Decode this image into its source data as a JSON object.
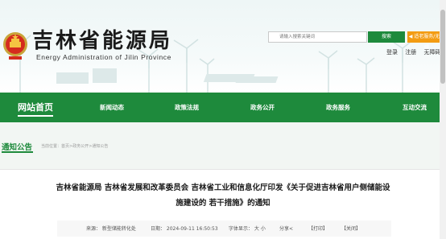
{
  "header": {
    "site_title": "吉林省能源局",
    "site_subtitle": "Energy Administration of Jilin Province",
    "search_placeholder": "请输入搜索关键词",
    "search_button": "搜索",
    "voice_button": "◀ 适老服务/无障碍",
    "top_links": [
      "登录",
      "注册",
      "无障碍"
    ]
  },
  "nav": {
    "items": [
      "网站首页",
      "新闻动态",
      "政策法规",
      "政务公开",
      "政务服务",
      "互动交流"
    ],
    "active_index": 0
  },
  "section": {
    "title": "通知公告",
    "breadcrumb": "当前位置：首页>政务公开>通知公告"
  },
  "article": {
    "title_line1": "吉林省能源局 吉林省发展和改革委员会  吉林省工业和信息化厅印发《关于促进吉林省用户侧储能设",
    "title_line2": "施建设的 若干措施》的通知",
    "meta": {
      "source": "来源：  新型储能转化处",
      "date": "日期：  2024-09-11 16:50:53",
      "font_size": "字体显示：  大  小",
      "share": "分享<",
      "print": "【打印】",
      "close": "【关闭】"
    }
  },
  "colors": {
    "brand_green": "#1e8a3c",
    "accent_orange": "#f39c12"
  }
}
